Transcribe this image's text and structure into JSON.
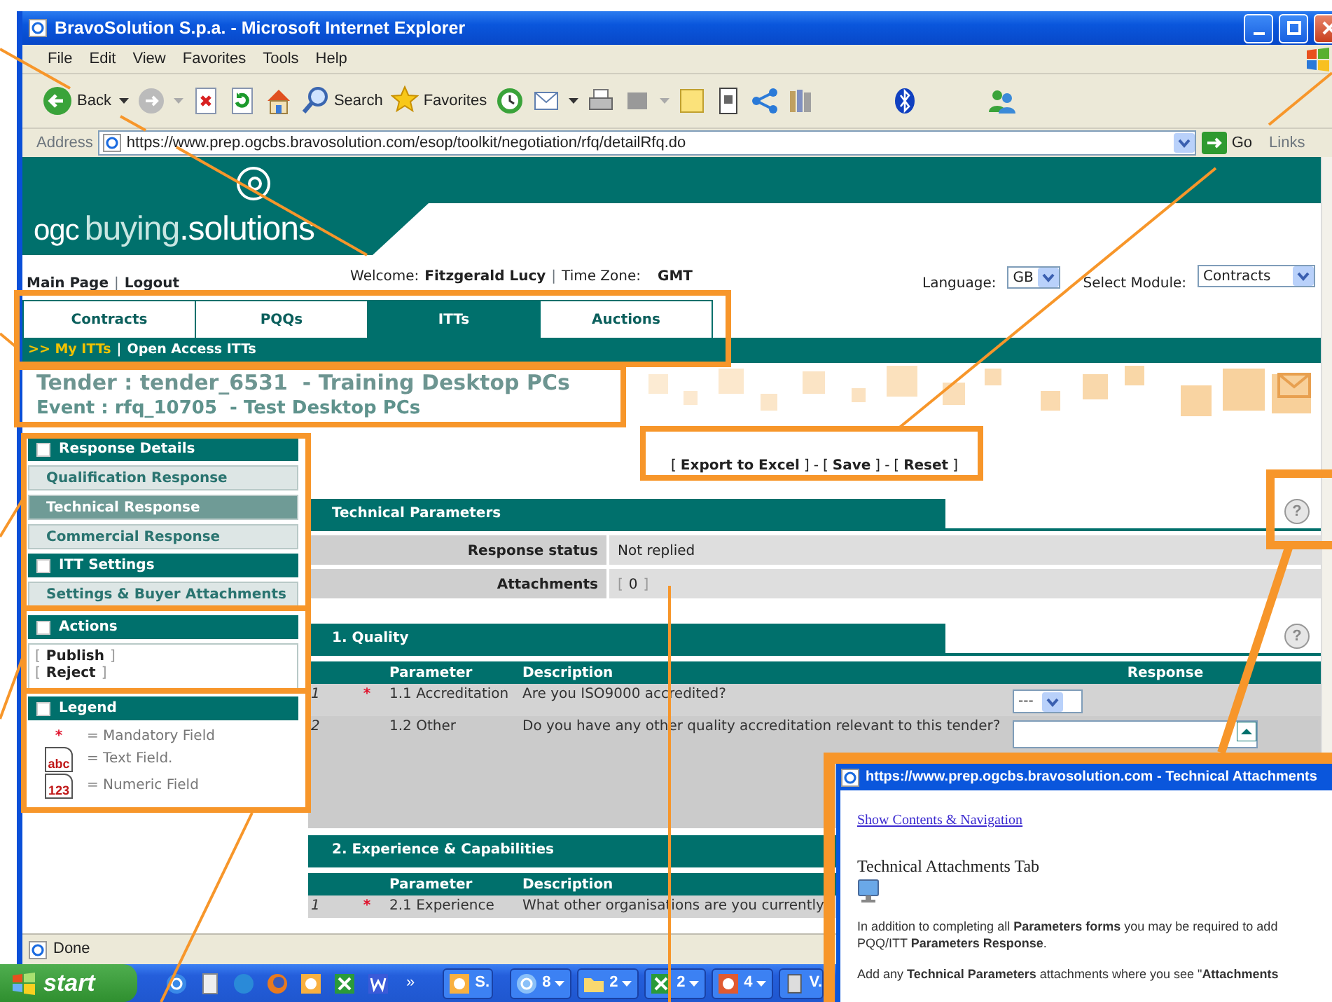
{
  "window": {
    "title": "BravoSolution S.p.a. - Microsoft Internet Explorer"
  },
  "menu": [
    "File",
    "Edit",
    "View",
    "Favorites",
    "Tools",
    "Help"
  ],
  "toolbar": [
    {
      "kind": "back",
      "label": "Back"
    },
    {
      "kind": "search",
      "label": "Search"
    },
    {
      "kind": "favorites",
      "label": "Favorites"
    }
  ],
  "address": {
    "label": "Address",
    "url": "https://www.prep.ogcbs.bravosolution.com/esop/toolkit/negotiation/rfq/detailRfq.do",
    "go": "Go",
    "links": "Links"
  },
  "page": {
    "logo": {
      "prefix": "ogc",
      "main": "buying",
      "suffix": ".solutions"
    },
    "separators": {
      "bar": "|",
      "open": "[",
      "close": "]",
      "dash": "-"
    },
    "help_symbol": "?",
    "top_links": [
      "Main Page",
      "Logout"
    ],
    "welcome": {
      "label": "Welcome:",
      "user": "Fitzgerald Lucy",
      "tz_label": "Time Zone:",
      "tz": "GMT"
    },
    "language": {
      "label": "Language:",
      "value": "GB"
    },
    "module": {
      "label": "Select Module:",
      "value": "Contracts"
    },
    "tabs": [
      {
        "label": "Contracts",
        "selected": false
      },
      {
        "label": "PQQs",
        "selected": false
      },
      {
        "label": "ITTs",
        "selected": true
      },
      {
        "label": "Auctions",
        "selected": false
      }
    ],
    "subnav": [
      {
        "label": ">> My ITTs",
        "selected": true
      },
      {
        "label": "Open Access ITTs",
        "selected": false
      }
    ],
    "tender": "Tender : tender_6531  - Training Desktop PCs",
    "event": "Event : rfq_10705  - Test Desktop PCs",
    "sidebar": [
      {
        "kind": "menu",
        "title": "Response Details",
        "items": [
          {
            "label": "Qualification Response",
            "selected": false
          },
          {
            "label": "Technical Response",
            "selected": true
          },
          {
            "label": "Commercial Response",
            "selected": false
          }
        ]
      },
      {
        "kind": "menu",
        "title": "ITT Settings",
        "items": [
          {
            "label": "Settings & Buyer Attachments",
            "selected": false
          }
        ]
      },
      {
        "kind": "actions",
        "title": "Actions",
        "links": [
          "Publish",
          "Reject"
        ]
      },
      {
        "kind": "legend",
        "title": "Legend",
        "entries": [
          {
            "kind": "mandatory",
            "symbol": "*",
            "label": "= Mandatory Field"
          },
          {
            "kind": "text",
            "symbol": "abc",
            "label": "= Text Field."
          },
          {
            "kind": "numeric",
            "symbol": "123",
            "label": "= Numeric Field"
          }
        ]
      }
    ],
    "export_links": [
      "Export to Excel",
      "Save",
      "Reset"
    ],
    "technical": {
      "title": "Technical Parameters",
      "fields": [
        {
          "label": "Response status",
          "value": "Not replied",
          "link": false
        },
        {
          "label": "Attachments",
          "value": "0",
          "link": true
        }
      ]
    },
    "sections": [
      {
        "title": "1. Quality",
        "help": true,
        "columns": [
          "Parameter",
          "Description",
          "Response"
        ],
        "rows": [
          {
            "index": "1",
            "mandatory": true,
            "parameter": "1.1 Accreditation",
            "description": "Are you ISO9000 accredited?",
            "kind": "select",
            "response": "---"
          },
          {
            "index": "2",
            "mandatory": false,
            "parameter": "1.2 Other",
            "description": "Do you have any other quality accreditation relevant to this tender?",
            "kind": "textarea"
          }
        ]
      },
      {
        "title": "2. Experience & Capabilities",
        "help": false,
        "columns": [
          "Parameter",
          "Description"
        ],
        "rows": [
          {
            "index": "1",
            "mandatory": true,
            "parameter": "2.1 Experience",
            "description": "What other organisations are you currently"
          }
        ]
      }
    ]
  },
  "status_bar": "Done",
  "taskbar": {
    "start": "start",
    "more": "»",
    "buttons": [
      {
        "kind": "clock",
        "label": "S."
      },
      {
        "kind": "ie",
        "label": "8"
      },
      {
        "kind": "folder",
        "label": "2"
      },
      {
        "kind": "excel",
        "label": "2"
      },
      {
        "kind": "app",
        "label": "4"
      },
      {
        "kind": "doc",
        "label": "V."
      }
    ]
  },
  "popup": {
    "title": "https://www.prep.ogcbs.bravosolution.com - Technical Attachments",
    "link": "Show Contents & Navigation",
    "heading": "Technical Attachments Tab",
    "paragraphs": [
      "In addition to completing all **Parameters forms** you may be required to add",
      "PQQ/ITT **Parameters Response**.",
      "Add any **Technical Parameters** attachments where you see \"**Attachments**"
    ]
  }
}
